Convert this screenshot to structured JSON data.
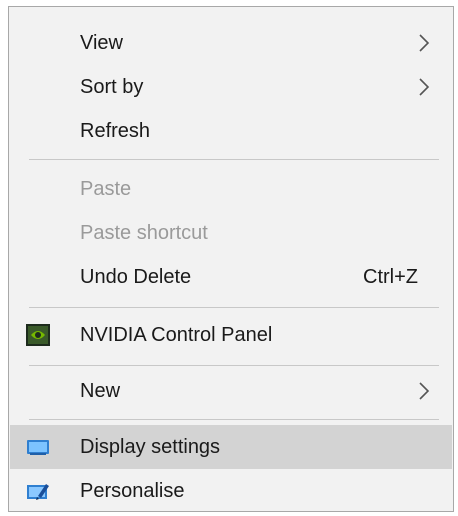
{
  "context_menu": {
    "items": [
      {
        "label": "View",
        "has_submenu": true,
        "enabled": true
      },
      {
        "label": "Sort by",
        "has_submenu": true,
        "enabled": true
      },
      {
        "label": "Refresh",
        "has_submenu": false,
        "enabled": true
      },
      {
        "label": "Paste",
        "has_submenu": false,
        "enabled": false
      },
      {
        "label": "Paste shortcut",
        "has_submenu": false,
        "enabled": false
      },
      {
        "label": "Undo Delete",
        "shortcut": "Ctrl+Z",
        "has_submenu": false,
        "enabled": true
      },
      {
        "label": "NVIDIA Control Panel",
        "icon": "nvidia-icon",
        "has_submenu": false,
        "enabled": true
      },
      {
        "label": "New",
        "has_submenu": true,
        "enabled": true
      },
      {
        "label": "Display settings",
        "icon": "display-icon",
        "has_submenu": false,
        "enabled": true,
        "highlighted": true
      },
      {
        "label": "Personalise",
        "icon": "personalise-icon",
        "has_submenu": false,
        "enabled": true
      }
    ]
  },
  "colors": {
    "menu_background": "#f2f2f2",
    "highlight": "#d3d3d3",
    "disabled_text": "#9a9a9a",
    "text": "#1a1a1a"
  }
}
